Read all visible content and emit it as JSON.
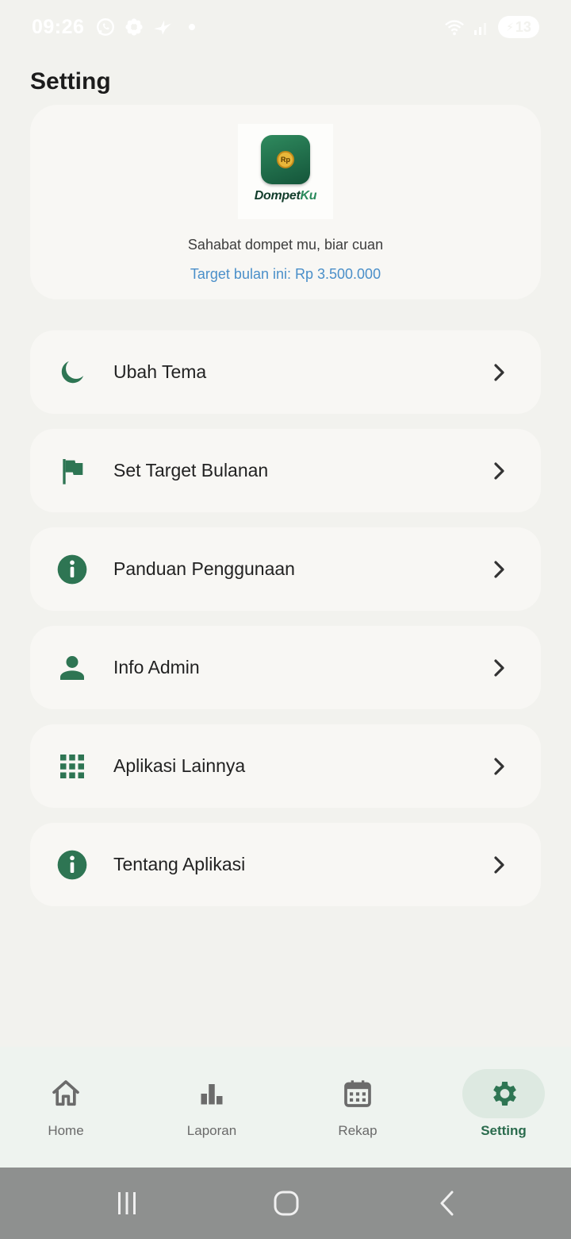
{
  "status_bar": {
    "time": "09:26",
    "left_icons": [
      "whatsapp-icon",
      "flower-icon",
      "bird-icon"
    ],
    "battery": "13"
  },
  "page": {
    "title": "Setting"
  },
  "profile": {
    "logo_text_a": "Dompet",
    "logo_text_b": "Ku",
    "logo_coin": "Rp",
    "tagline": "Sahabat dompet mu, biar cuan",
    "target": "Target bulan ini: Rp 3.500.000"
  },
  "menu": {
    "items": [
      {
        "label": "Ubah Tema",
        "icon": "moon-icon"
      },
      {
        "label": "Set Target Bulanan",
        "icon": "flag-icon"
      },
      {
        "label": "Panduan Penggunaan",
        "icon": "info-icon"
      },
      {
        "label": "Info Admin",
        "icon": "person-icon"
      },
      {
        "label": "Aplikasi Lainnya",
        "icon": "grid-icon"
      },
      {
        "label": "Tentang Aplikasi",
        "icon": "info-icon"
      }
    ]
  },
  "bottom_nav": {
    "items": [
      {
        "label": "Home",
        "icon": "home-icon"
      },
      {
        "label": "Laporan",
        "icon": "bar-chart-icon"
      },
      {
        "label": "Rekap",
        "icon": "calendar-icon"
      },
      {
        "label": "Setting",
        "icon": "gear-icon"
      }
    ],
    "active": "Setting"
  },
  "colors": {
    "accent": "#2e7553",
    "link": "#4a8fc9",
    "background": "#f2f2ee",
    "card": "#f8f7f4"
  }
}
